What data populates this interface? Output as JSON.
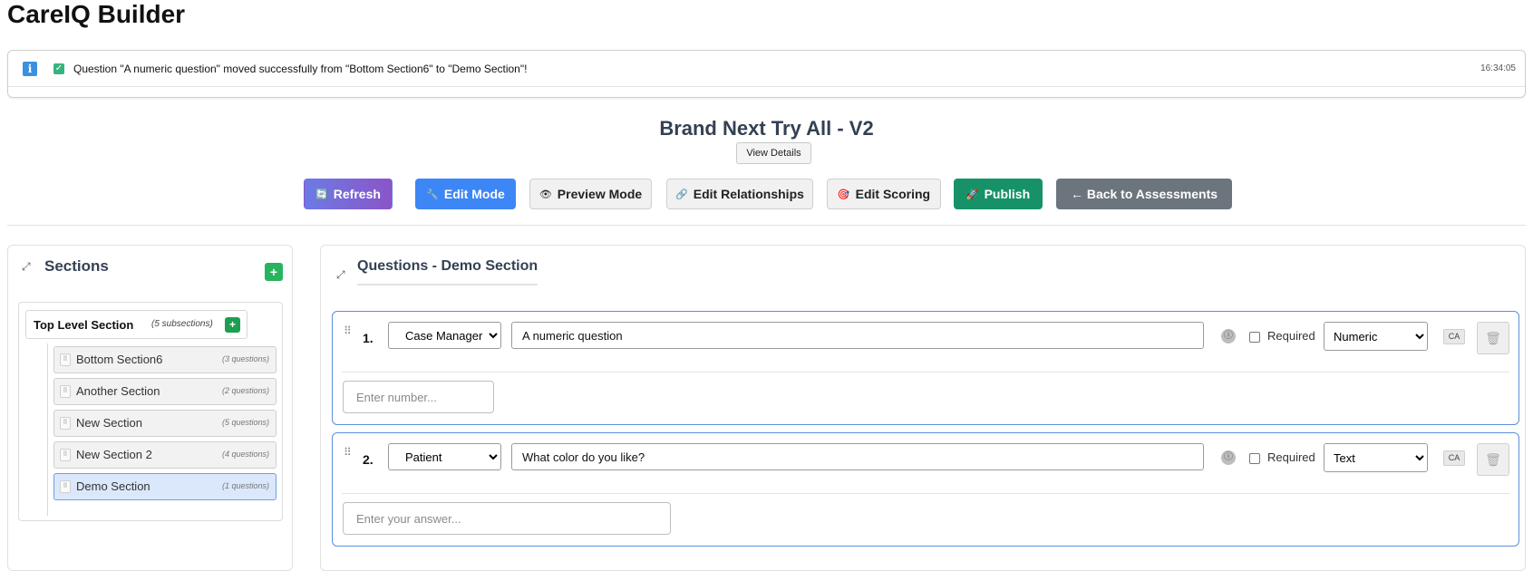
{
  "app": {
    "title": "CareIQ Builder"
  },
  "notification": {
    "message": "Question \"A numeric question\" moved successfully from \"Bottom Section6\" to \"Demo Section\"!",
    "time": "16:34:05"
  },
  "assessment": {
    "title": "Brand Next Try All - V2",
    "view_details_label": "View Details"
  },
  "toolbar": {
    "refresh": "Refresh",
    "edit_mode": "Edit Mode",
    "preview_mode": "Preview Mode",
    "edit_relationships": "Edit Relationships",
    "edit_scoring": "Edit Scoring",
    "publish": "Publish",
    "back": "← Back to Assessments"
  },
  "sections_panel": {
    "title": "Sections",
    "top_level": {
      "name": "Top Level Section",
      "subsections": "(5 subsections)"
    },
    "items": [
      {
        "name": "Bottom Section6",
        "count": "(3 questions)"
      },
      {
        "name": "Another Section",
        "count": "(2 questions)"
      },
      {
        "name": "New Section",
        "count": "(5 questions)"
      },
      {
        "name": "New Section 2",
        "count": "(4 questions)"
      },
      {
        "name": "Demo Section",
        "count": "(1 questions)"
      }
    ]
  },
  "questions_panel": {
    "title": "Questions - Demo Section",
    "questions": [
      {
        "number": "1.",
        "respondent": "Case Manager",
        "text": "A numeric question",
        "required_label": "Required",
        "type": "Numeric",
        "ca_label": "CA",
        "answer_placeholder": "Enter number..."
      },
      {
        "number": "2.",
        "respondent": "Patient",
        "text": "What color do you like?",
        "required_label": "Required",
        "type": "Text",
        "ca_label": "CA",
        "answer_placeholder": "Enter your answer..."
      }
    ]
  },
  "icons": {
    "info": "info-icon",
    "check": "check-icon",
    "refresh": "refresh-icon",
    "edit": "wrench-icon",
    "preview": "eye-icon",
    "relationships": "link-icon",
    "scoring": "target-icon",
    "publish": "rocket-icon",
    "expand": "expand-icon",
    "add": "plus-icon",
    "drag": "drag-handle-icon",
    "delete": "trash-icon"
  },
  "colors": {
    "primary": "#3d86f5",
    "publish": "#179268",
    "back": "#6c757d",
    "add": "#28b45e",
    "title": "#344154"
  }
}
